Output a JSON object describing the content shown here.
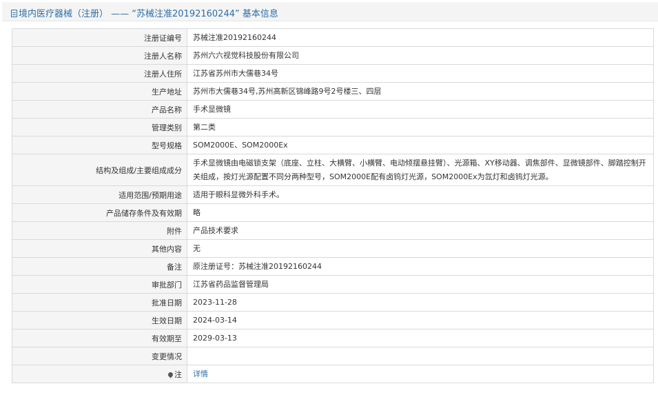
{
  "header": {
    "title": "境内医疗器械（注册） —— “苏械注准20192160244” 基本信息"
  },
  "rows": [
    {
      "label": "注册证编号",
      "value": "苏械注准20192160244"
    },
    {
      "label": "注册人名称",
      "value": "苏州六六视觉科技股份有限公司"
    },
    {
      "label": "注册人住所",
      "value": "江苏省苏州市大儒巷34号"
    },
    {
      "label": "生产地址",
      "value": "苏州市大儒巷34号,苏州高新区锦峰路9号2号楼三、四层"
    },
    {
      "label": "产品名称",
      "value": "手术显微镜"
    },
    {
      "label": "管理类别",
      "value": "第二类"
    },
    {
      "label": "型号规格",
      "value": "SOM2000E、SOM2000Ex"
    },
    {
      "label": "结构及组成/主要组成成分",
      "value": "手术显微镜由电磁锁支架（底座、立柱、大横臂、小横臂、电动倾摆悬挂臂）、光源箱、XY移动器、调焦部件、显微镜部件、脚踏控制开关组成，按灯光源配置不同分两种型号，SOM2000E配有卤钨灯光源，SOM2000Ex为氙灯和卤钨灯光源。"
    },
    {
      "label": "适用范围/预期用途",
      "value": "适用于眼科显微外科手术。"
    },
    {
      "label": "产品储存条件及有效期",
      "value": "略"
    },
    {
      "label": "附件",
      "value": "产品技术要求"
    },
    {
      "label": "其他内容",
      "value": "无"
    },
    {
      "label": "备注",
      "value": "原注册证号：苏械注准20192160244"
    },
    {
      "label": "审批部门",
      "value": "江苏省药品监督管理局"
    },
    {
      "label": "批准日期",
      "value": "2023-11-28"
    },
    {
      "label": "生效日期",
      "value": "2024-03-14"
    },
    {
      "label": "有效期至",
      "value": "2029-03-13"
    },
    {
      "label": "变更情况",
      "value": ""
    }
  ],
  "note": {
    "label": "注",
    "link_text": "详情",
    "icon": "pin-icon"
  },
  "colors": {
    "link": "#2c6ea8",
    "label_bg": "#f5f5f5",
    "border": "#d9d9d9",
    "header_bg": "#f4f4f4"
  }
}
